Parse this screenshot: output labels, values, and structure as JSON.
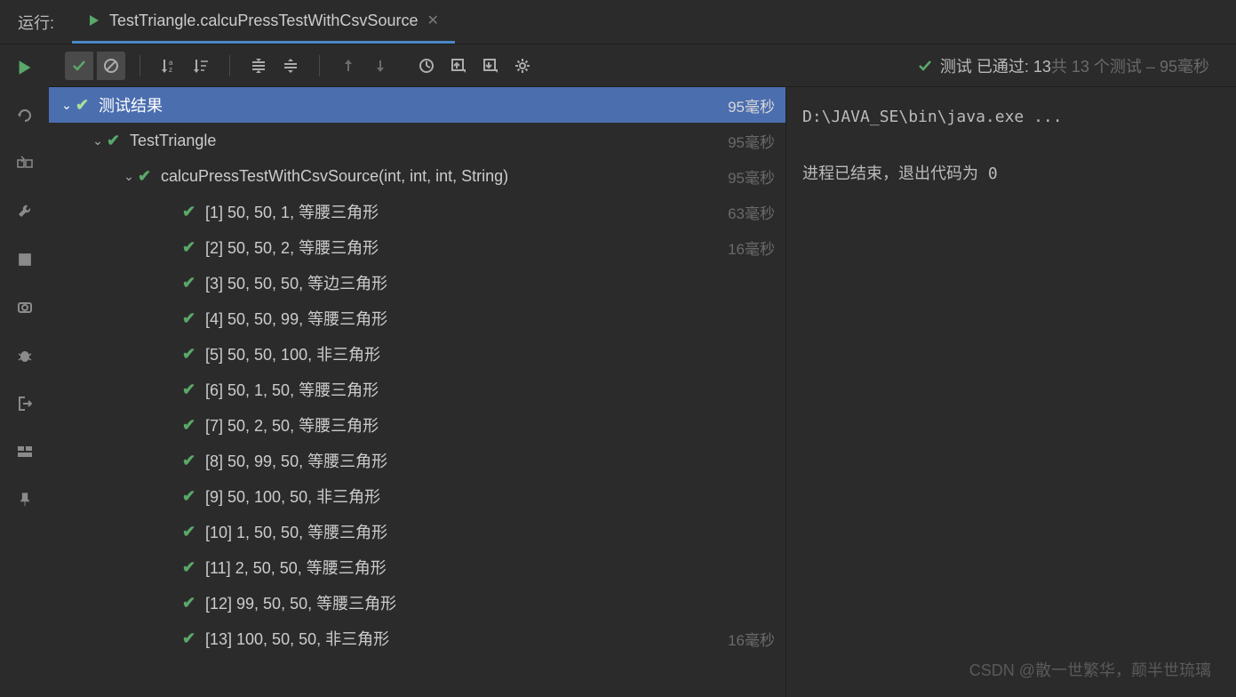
{
  "header": {
    "run_label": "运行:",
    "tab_title": "TestTriangle.calcuPressTestWithCsvSource"
  },
  "toolbar": {
    "status_prefix": "测试 已通过:",
    "status_count": "13",
    "status_total": "共 13 个测试",
    "status_time": "– 95毫秒"
  },
  "tree": {
    "root": {
      "label": "测试结果",
      "time": "95毫秒"
    },
    "class": {
      "label": "TestTriangle",
      "time": "95毫秒"
    },
    "method": {
      "label": "calcuPressTestWithCsvSource(int, int, int, String)",
      "time": "95毫秒"
    },
    "tests": [
      {
        "label": "[1] 50, 50, 1, 等腰三角形",
        "time": "63毫秒"
      },
      {
        "label": "[2] 50, 50, 2, 等腰三角形",
        "time": "16毫秒"
      },
      {
        "label": "[3] 50, 50, 50, 等边三角形",
        "time": ""
      },
      {
        "label": "[4] 50, 50, 99, 等腰三角形",
        "time": ""
      },
      {
        "label": "[5] 50, 50, 100, 非三角形",
        "time": ""
      },
      {
        "label": "[6] 50, 1, 50, 等腰三角形",
        "time": ""
      },
      {
        "label": "[7] 50, 2, 50, 等腰三角形",
        "time": ""
      },
      {
        "label": "[8] 50, 99, 50, 等腰三角形",
        "time": ""
      },
      {
        "label": "[9] 50, 100, 50, 非三角形",
        "time": ""
      },
      {
        "label": "[10] 1, 50, 50, 等腰三角形",
        "time": ""
      },
      {
        "label": "[11] 2, 50, 50, 等腰三角形",
        "time": ""
      },
      {
        "label": "[12] 99, 50, 50, 等腰三角形",
        "time": ""
      },
      {
        "label": "[13] 100, 50, 50, 非三角形",
        "time": "16毫秒"
      }
    ]
  },
  "console": {
    "line1": "D:\\JAVA_SE\\bin\\java.exe ...",
    "line2": "进程已结束，退出代码为 0"
  },
  "watermark": "CSDN @散一世繁华，颠半世琉璃"
}
